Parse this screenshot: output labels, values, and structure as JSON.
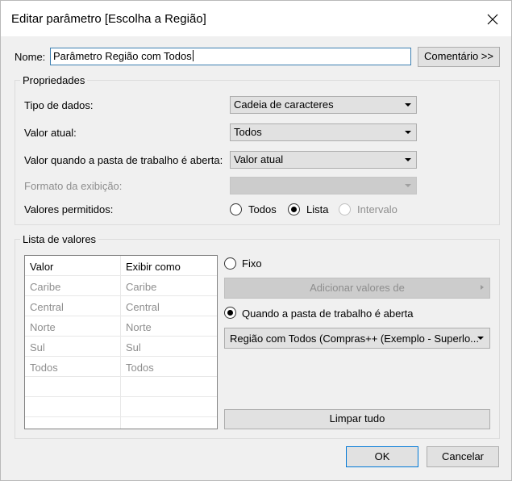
{
  "dialog": {
    "title": "Editar parâmetro [Escolha a Região]",
    "close_icon": "close-icon"
  },
  "name_row": {
    "label": "Nome:",
    "value": "Parâmetro Região com Todos",
    "comment_button": "Comentário >>"
  },
  "properties": {
    "title": "Propriedades",
    "data_type": {
      "label": "Tipo de dados:",
      "value": "Cadeia de caracteres"
    },
    "current_value": {
      "label": "Valor atual:",
      "value": "Todos"
    },
    "on_open": {
      "label": "Valor quando a pasta de trabalho é aberta:",
      "value": "Valor atual"
    },
    "display_format": {
      "label": "Formato da exibição:",
      "value": ""
    },
    "allowed_values": {
      "label": "Valores permitidos:",
      "options": [
        "Todos",
        "Lista",
        "Intervalo"
      ],
      "selected": "Lista"
    }
  },
  "list_of_values": {
    "title": "Lista de valores",
    "columns": [
      "Valor",
      "Exibir como"
    ],
    "rows": [
      [
        "Caribe",
        "Caribe"
      ],
      [
        "Central",
        "Central"
      ],
      [
        "Norte",
        "Norte"
      ],
      [
        "Sul",
        "Sul"
      ],
      [
        "Todos",
        "Todos"
      ]
    ],
    "fixed_label": "Fixo",
    "add_values_button": "Adicionar valores de",
    "when_open_label": "Quando a pasta de trabalho é aberta",
    "source_dropdown": "Região com Todos (Compras++ (Exemplo - Superlo...",
    "clear_button": "Limpar tudo"
  },
  "footer": {
    "ok": "OK",
    "cancel": "Cancelar"
  }
}
